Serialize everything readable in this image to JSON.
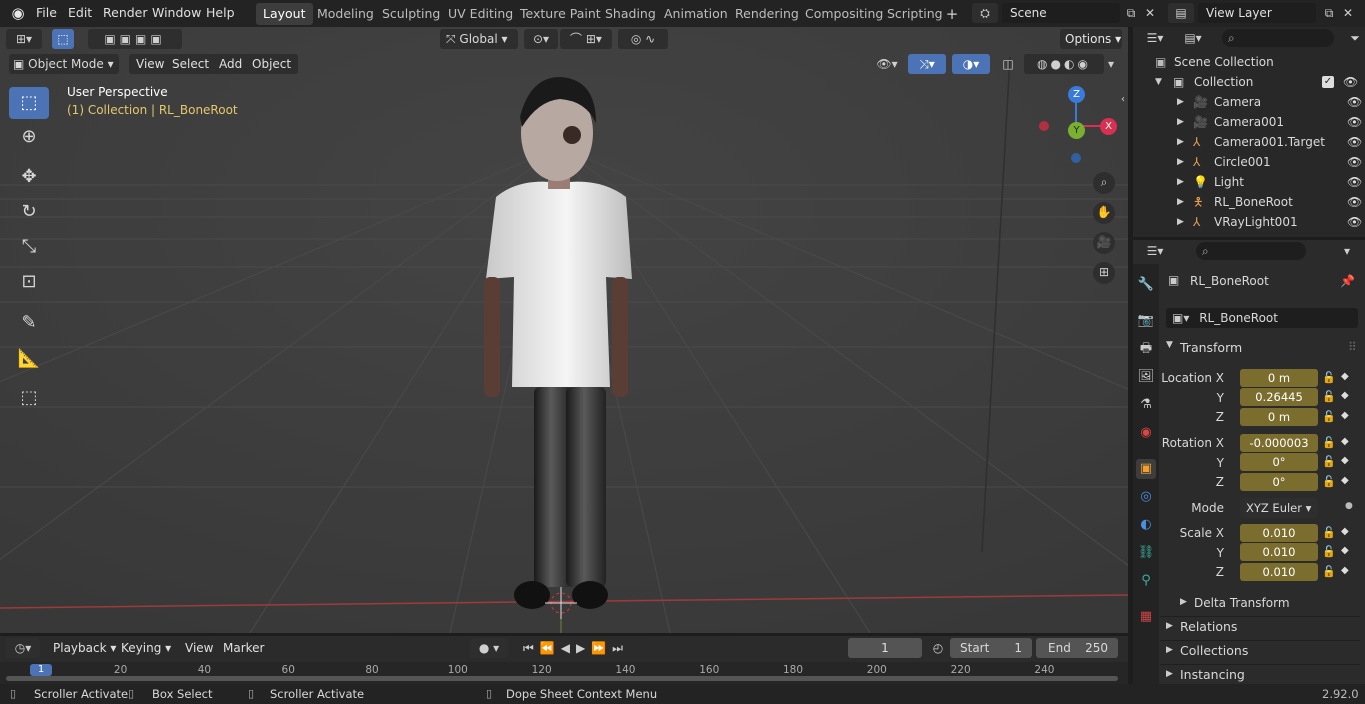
{
  "app": {
    "version": "2.92.0"
  },
  "topbar": {
    "menus": [
      "File",
      "Edit",
      "Render",
      "Window",
      "Help"
    ],
    "workspaces": [
      "Layout",
      "Modeling",
      "Sculpting",
      "UV Editing",
      "Texture Paint",
      "Shading",
      "Animation",
      "Rendering",
      "Compositing",
      "Scripting"
    ],
    "active_workspace": "Layout",
    "scene_name": "Scene",
    "view_layer": "View Layer"
  },
  "viewport_header": {
    "transform_orientation": "Global",
    "options_label": "Options",
    "mode": "Object Mode",
    "menus": [
      "View",
      "Select",
      "Add",
      "Object"
    ]
  },
  "viewport": {
    "perspective_label": "User Perspective",
    "context_label": "(1) Collection | RL_BoneRoot",
    "gizmo_axes": {
      "x": "X",
      "y": "Y",
      "z": "Z"
    }
  },
  "outliner": {
    "root": "Scene Collection",
    "collection": "Collection",
    "items": [
      {
        "name": "Camera",
        "icon": "camera-icon"
      },
      {
        "name": "Camera001",
        "icon": "camera-icon"
      },
      {
        "name": "Camera001.Target",
        "icon": "empty-icon"
      },
      {
        "name": "Circle001",
        "icon": "empty-icon"
      },
      {
        "name": "Light",
        "icon": "light-icon"
      },
      {
        "name": "RL_BoneRoot",
        "icon": "armature-icon"
      },
      {
        "name": "VRayLight001",
        "icon": "empty-icon"
      }
    ]
  },
  "properties": {
    "object_name": "RL_BoneRoot",
    "datablock_name": "RL_BoneRoot",
    "transform_label": "Transform",
    "location_label": "Location X",
    "location": {
      "x": "0 m",
      "y": "0.26445",
      "z": "0 m"
    },
    "rotation_label": "Rotation X",
    "rotation": {
      "x": "-0.000003",
      "y": "0°",
      "z": "0°"
    },
    "mode_label": "Mode",
    "rotation_mode": "XYZ Euler",
    "scale_label": "Scale X",
    "scale": {
      "x": "0.010",
      "y": "0.010",
      "z": "0.010"
    },
    "axis_y": "Y",
    "axis_z": "Z",
    "delta_transform": "Delta Transform",
    "panels": [
      "Relations",
      "Collections",
      "Instancing"
    ]
  },
  "timeline": {
    "menus": [
      "Playback",
      "Keying",
      "View",
      "Marker"
    ],
    "current_frame": "1",
    "start_label": "Start",
    "start": "1",
    "end_label": "End",
    "end": "250",
    "ruler": [
      "1",
      "20",
      "40",
      "60",
      "80",
      "100",
      "120",
      "140",
      "160",
      "180",
      "200",
      "220",
      "240"
    ]
  },
  "status": {
    "items": [
      "Scroller Activate",
      "Box Select",
      "Scroller Activate",
      "Dope Sheet Context Menu"
    ]
  }
}
